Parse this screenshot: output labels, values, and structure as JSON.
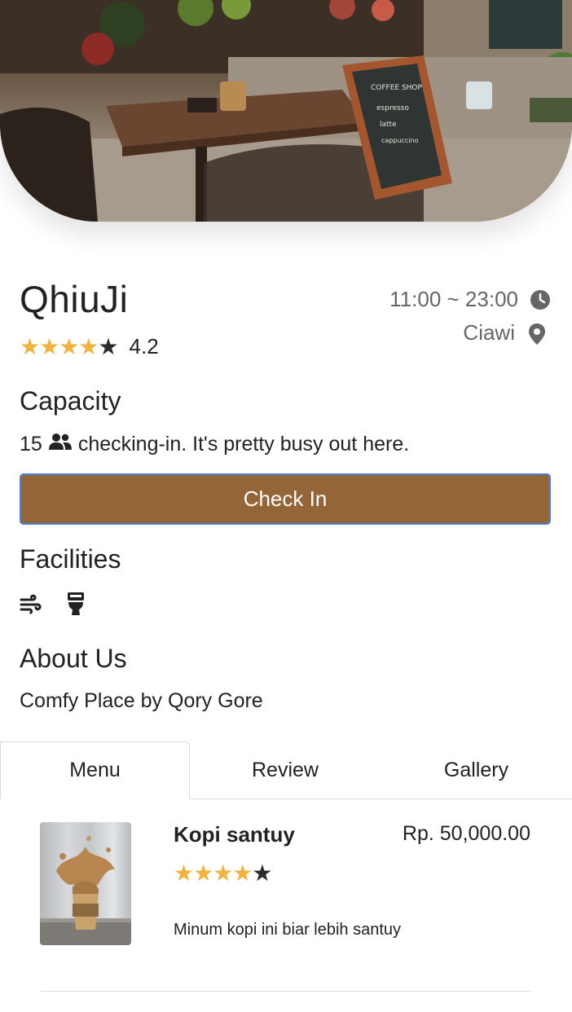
{
  "cafe": {
    "name": "QhiuJi",
    "rating_stars": "★★★★",
    "rating_star_empty": "★",
    "rating_value": "4.2",
    "hours": "11:00 ~ 23:00",
    "location": "Ciawi"
  },
  "capacity": {
    "title": "Capacity",
    "count": "15",
    "text": "checking-in. It's pretty busy out here."
  },
  "checkin": {
    "label": "Check In"
  },
  "facilities": {
    "title": "Facilities",
    "items": [
      "wind-icon",
      "toilet-icon"
    ]
  },
  "about": {
    "title": "About Us",
    "text": "Comfy Place by Qory Gore"
  },
  "tabs": [
    {
      "label": "Menu",
      "active": true
    },
    {
      "label": "Review",
      "active": false
    },
    {
      "label": "Gallery",
      "active": false
    }
  ],
  "menu": {
    "items": [
      {
        "name": "Kopi santuy",
        "price": "Rp. 50,000.00",
        "stars": "★★★★",
        "star_empty": "★",
        "rating": 4,
        "description": "Minum kopi ini biar lebih santuy"
      }
    ]
  },
  "colors": {
    "accent": "#936537",
    "star": "#f2b33d",
    "button_border": "#4a7fdc"
  }
}
